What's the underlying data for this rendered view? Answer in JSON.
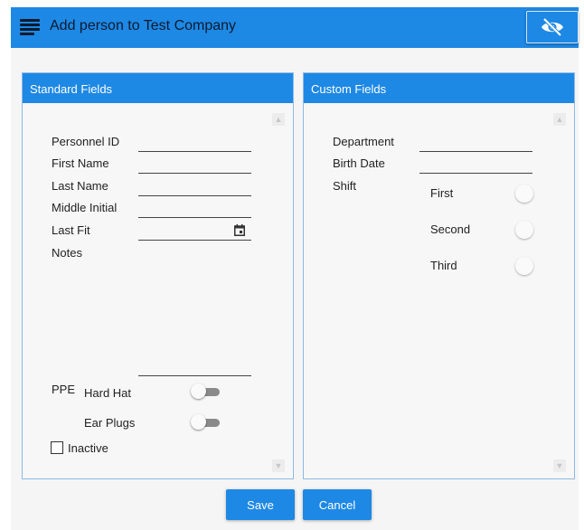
{
  "header": {
    "title": "Add person to Test Company",
    "menu_icon": "hamburger-menu-icon",
    "visibility_icon": "eye-off-icon"
  },
  "standard": {
    "title": "Standard Fields",
    "labels": {
      "personnel_id": "Personnel ID",
      "first_name": "First Name",
      "last_name": "Last Name",
      "middle_initial": "Middle Initial",
      "last_fit": "Last Fit",
      "notes": "Notes",
      "ppe": "PPE",
      "hard_hat": "Hard Hat",
      "ear_plugs": "Ear Plugs",
      "inactive": "Inactive"
    },
    "values": {
      "personnel_id": "",
      "first_name": "",
      "last_name": "",
      "middle_initial": "",
      "last_fit": "",
      "notes": ""
    },
    "toggles": {
      "hard_hat": false,
      "ear_plugs": false
    },
    "inactive_checked": false
  },
  "custom": {
    "title": "Custom Fields",
    "labels": {
      "department": "Department",
      "birth_date": "Birth Date",
      "shift": "Shift"
    },
    "values": {
      "department": "",
      "birth_date": ""
    },
    "shift_options": [
      "First",
      "Second",
      "Third"
    ]
  },
  "actions": {
    "save": "Save",
    "cancel": "Cancel"
  },
  "colors": {
    "accent": "#1e88e5",
    "dark_text": "#0b1b2e"
  }
}
